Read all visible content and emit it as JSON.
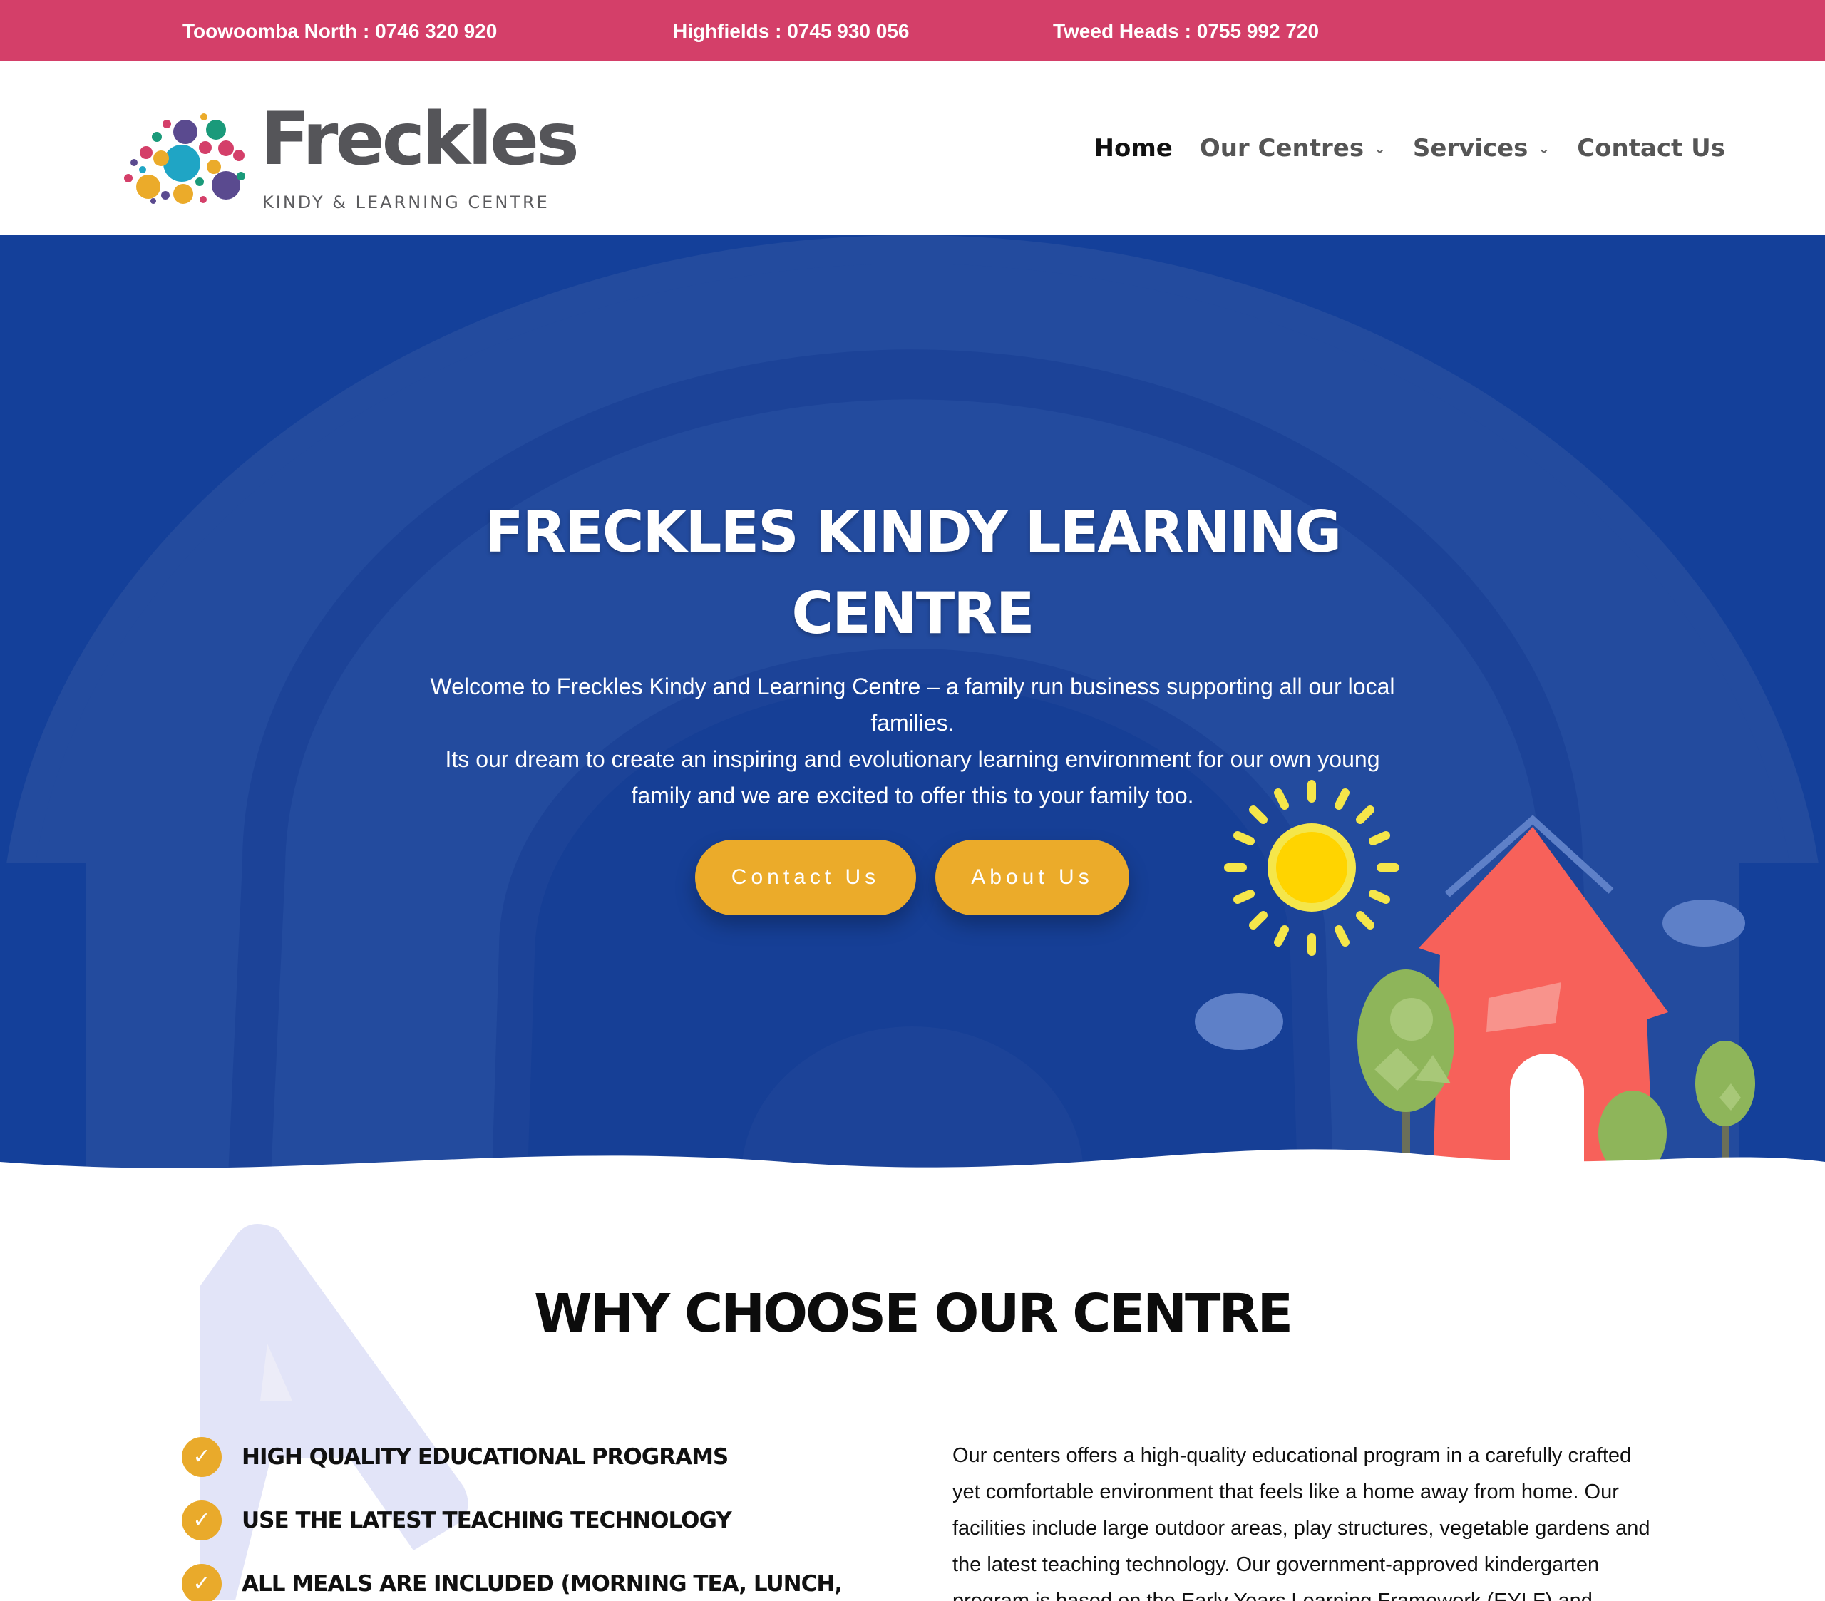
{
  "topbar": {
    "phones": [
      "Toowoomba North : 0746 320 920",
      "Highfields : 0745 930 056",
      "Tweed Heads : 0755 992 720"
    ]
  },
  "logo": {
    "name": "Freckles",
    "tagline": "KINDY & LEARNING CENTRE"
  },
  "nav": {
    "items": [
      {
        "label": "Home"
      },
      {
        "label": "Our Centres"
      },
      {
        "label": "Services"
      },
      {
        "label": "Contact Us"
      }
    ]
  },
  "hero": {
    "title_line1": "FRECKLES KINDY LEARNING",
    "title_line2": "CENTRE",
    "text_line1": "Welcome to Freckles Kindy and Learning Centre – a family run business supporting all our local families.",
    "text_line2": "Its our dream to create an inspiring and evolutionary learning environment for our own young family and we are excited to offer this to your family too.",
    "contact_button": "Contact Us",
    "about_button": "About Us"
  },
  "why": {
    "title": "WHY CHOOSE OUR CENTRE",
    "features": [
      "HIGH QUALITY EDUCATIONAL PROGRAMS",
      "USE THE LATEST TEACHING TECHNOLOGY",
      "ALL MEALS ARE INCLUDED (MORNING TEA, LUNCH,"
    ],
    "check_glyph": "✓",
    "paragraph": "Our centers offers a high-quality educational program in a carefully crafted yet comfortable environment that feels like a home away from home. Our facilities include large outdoor areas, play structures, vegetable gardens and the latest teaching technology. Our government-approved kindergarten program is based on the Early Years Learning Framework (EYLF) and taught"
  },
  "colors": {
    "topbar": "#d43f69",
    "hero": "#14409a",
    "accent": "#ebab2a"
  }
}
